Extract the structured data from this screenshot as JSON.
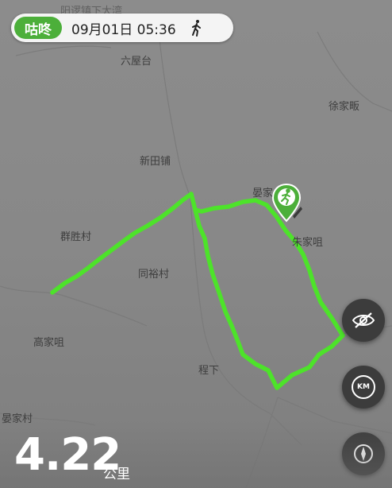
{
  "header": {
    "app_name": "咕咚",
    "datetime": "09月01日 05:36",
    "activity_icon": "walking-person-icon"
  },
  "map": {
    "places": {
      "top": "阳逻镇下大湾",
      "liuwutai": "六屋台",
      "xujiafan": "徐家畈",
      "xintianpu": "新田铺",
      "qunshengcun": "群胜村",
      "tongyucun": "同裕村",
      "yanjiazui_top": "晏家",
      "zhujiazui": "朱家咀",
      "gaojiazui": "高家咀",
      "chengxia": "程下",
      "yanjiacun": "晏家村"
    },
    "route_color": "#4de32a",
    "marker_icon": "runner-pin-icon"
  },
  "controls": {
    "hide_icon": "eye-slash-icon",
    "km_label": "KM",
    "compass_icon": "compass-icon"
  },
  "stats": {
    "distance": "4.22",
    "unit": "公里"
  }
}
